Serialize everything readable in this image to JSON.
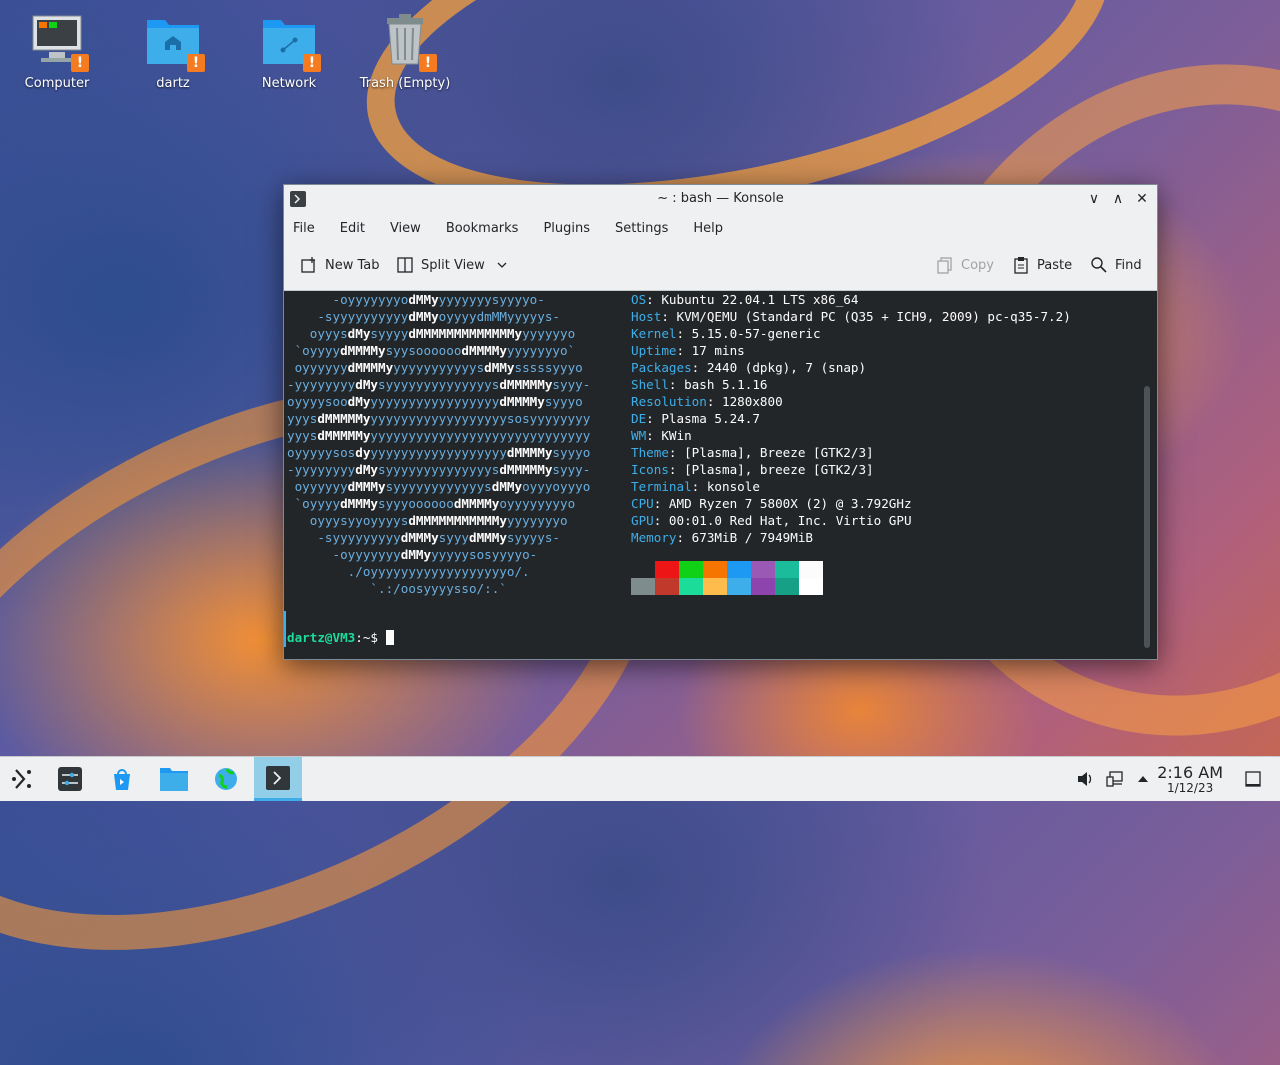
{
  "desktop": {
    "icons": [
      {
        "label": "Computer"
      },
      {
        "label": "dartz"
      },
      {
        "label": "Network"
      },
      {
        "label": "Trash (Empty)"
      }
    ],
    "warning_glyph": "!"
  },
  "window": {
    "title": "~ : bash — Konsole",
    "controls": {
      "minimize": "∨",
      "maximize": "∧",
      "close": "✕"
    },
    "menu": [
      "File",
      "Edit",
      "View",
      "Bookmarks",
      "Plugins",
      "Settings",
      "Help"
    ],
    "toolbar": {
      "new_tab": "New Tab",
      "split_view": "Split View",
      "copy": "Copy",
      "paste": "Paste",
      "find": "Find"
    }
  },
  "neofetch": {
    "ascii": [
      "      -oyyyyyyyodMMyyyyyyyysyyyyo-",
      "    -syyyyyyyyyydMMyoyyyydmMMyyyyys-",
      "   oyyysdMysyyyydMMMMMMMMMMMMMyyyyyyyo",
      " `oyyyydMMMMysyysoooooodMMMMyyyyyyyyo`",
      " oyyyyyydMMMMyyyyyyyyyyyysdMMysssssyyyo",
      "-yyyyyyyydMysyyyyyyyyyyyyyysdMMMMMysyyy-",
      "oyyyysoodMyyyyyyyyyyyyyyyyyydMMMMysyyyo",
      "yyysdMMMMMyyyyyyyyyyyyyyyyyyysosyyyyyyyy",
      "yyysdMMMMMyyyyyyyyyyyyyyyyyyyyyyyyyyyyyy",
      "oyyyyysosdyyyyyyyyyyyyyyyyyyydMMMMysyyyo",
      "-yyyyyyyydMysyyyyyyyyyyyyyysdMMMMMysyyy-",
      " oyyyyyydMMMysyyyyyyyyyyyysdMMyoyyyoyyyo",
      " `oyyyydMMMysyyyoooooodMMMMyoyyyyyyyyo",
      "   oyyysyyoyyyysdMMMMMMMMMMMyyyyyyyyo",
      "    -syyyyyyyyydMMMysyyydMMMysyyyys-",
      "      -oyyyyyyydMMyyyyyysosyyyyo-",
      "        ./oyyyyyyyyyyyyyyyyyyo/.",
      "           `.:/oosyyyysso/:.`"
    ],
    "info": [
      {
        "key": "OS",
        "value": "Kubuntu 22.04.1 LTS x86_64"
      },
      {
        "key": "Host",
        "value": "KVM/QEMU (Standard PC (Q35 + ICH9, 2009) pc-q35-7.2)"
      },
      {
        "key": "Kernel",
        "value": "5.15.0-57-generic"
      },
      {
        "key": "Uptime",
        "value": "17 mins"
      },
      {
        "key": "Packages",
        "value": "2440 (dpkg), 7 (snap)"
      },
      {
        "key": "Shell",
        "value": "bash 5.1.16"
      },
      {
        "key": "Resolution",
        "value": "1280x800"
      },
      {
        "key": "DE",
        "value": "Plasma 5.24.7"
      },
      {
        "key": "WM",
        "value": "KWin"
      },
      {
        "key": "Theme",
        "value": "[Plasma], Breeze [GTK2/3]"
      },
      {
        "key": "Icons",
        "value": "[Plasma], breeze [GTK2/3]"
      },
      {
        "key": "Terminal",
        "value": "konsole"
      },
      {
        "key": "CPU",
        "value": "AMD Ryzen 7 5800X (2) @ 3.792GHz"
      },
      {
        "key": "GPU",
        "value": "00:01.0 Red Hat, Inc. Virtio GPU"
      },
      {
        "key": "Memory",
        "value": "673MiB / 7949MiB"
      }
    ],
    "palette_top": [
      "#232629",
      "#ed1515",
      "#11d116",
      "#f67400",
      "#1d99f3",
      "#9b59b6",
      "#1abc9c",
      "#fcfcfc"
    ],
    "palette_bottom": [
      "#7f8c8d",
      "#c0392b",
      "#1cdc9a",
      "#fdbc4b",
      "#3daee9",
      "#8e44ad",
      "#16a085",
      "#ffffff"
    ]
  },
  "prompt": {
    "user": "dartz@VM3",
    "path": ":~$"
  },
  "taskbar": {
    "time": "2:16 AM",
    "date": "1/12/23"
  },
  "colors": {
    "accent": "#3daee9",
    "warning": "#f47b20",
    "folder": "#3daee9"
  }
}
